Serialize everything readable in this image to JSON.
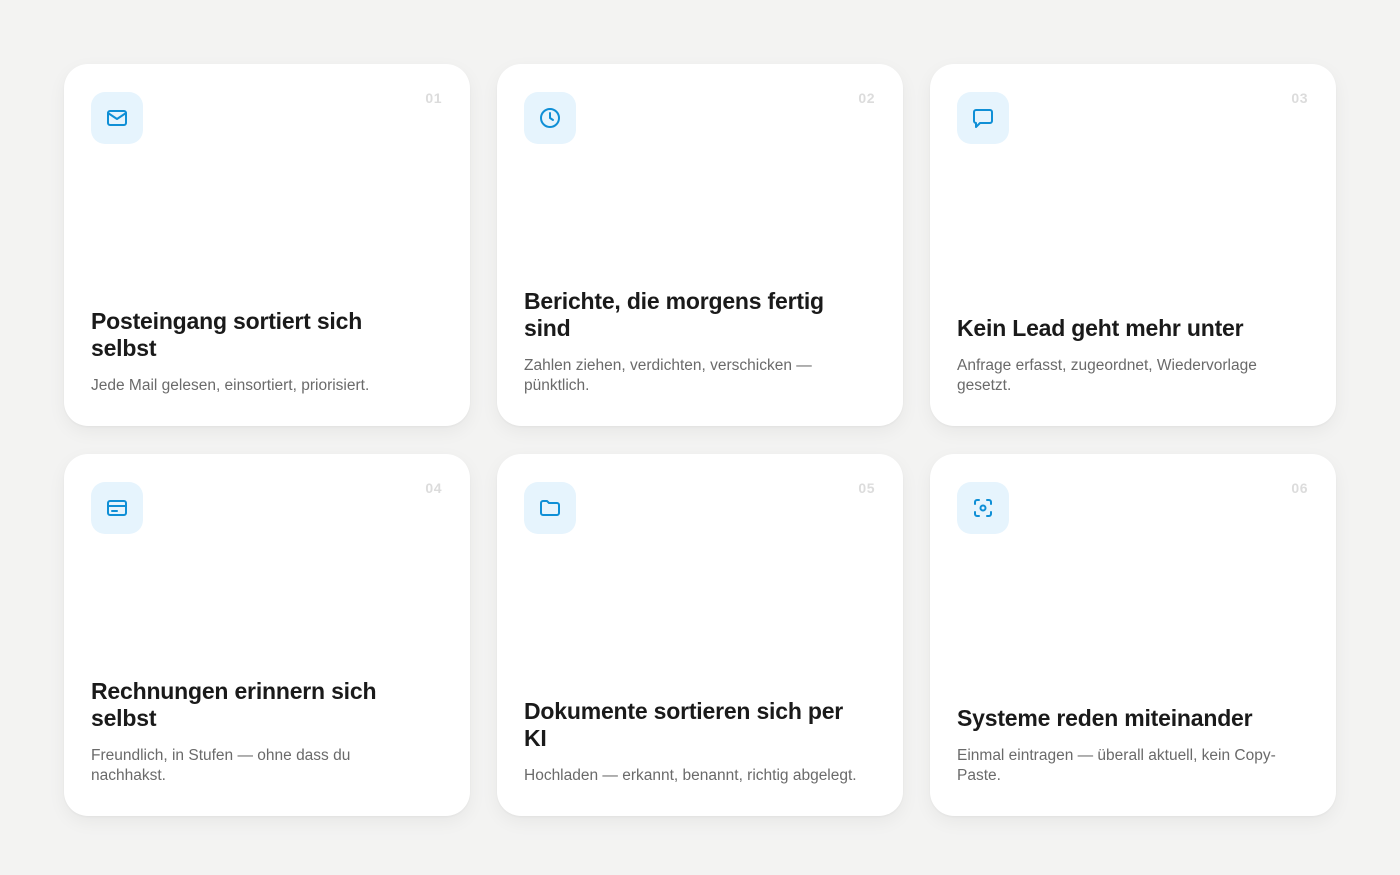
{
  "cards": [
    {
      "number": "01",
      "icon": "mail-icon",
      "title": "Posteingang sortiert sich selbst",
      "description": "Jede Mail gelesen, einsortiert, priorisiert."
    },
    {
      "number": "02",
      "icon": "clock-icon",
      "title": "Berichte, die morgens fertig sind",
      "description": "Zahlen ziehen, verdichten, verschicken — pünktlich."
    },
    {
      "number": "03",
      "icon": "message-icon",
      "title": "Kein Lead geht mehr unter",
      "description": "Anfrage erfasst, zugeordnet, Wiedervorlage gesetzt."
    },
    {
      "number": "04",
      "icon": "credit-card-icon",
      "title": "Rechnungen erinnern sich selbst",
      "description": "Freundlich, in Stufen — ohne dass du nachhakst."
    },
    {
      "number": "05",
      "icon": "folder-icon",
      "title": "Dokumente sortieren sich per KI",
      "description": "Hochladen — erkannt, benannt, richtig abgelegt."
    },
    {
      "number": "06",
      "icon": "scan-icon",
      "title": "Systeme reden miteinander",
      "description": "Einmal eintragen — überall aktuell, kein Copy-Paste."
    }
  ],
  "colors": {
    "accent": "#0f8fd6",
    "icon_background": "#e6f4fd",
    "page_background": "#f3f3f2",
    "card_background": "#ffffff"
  }
}
